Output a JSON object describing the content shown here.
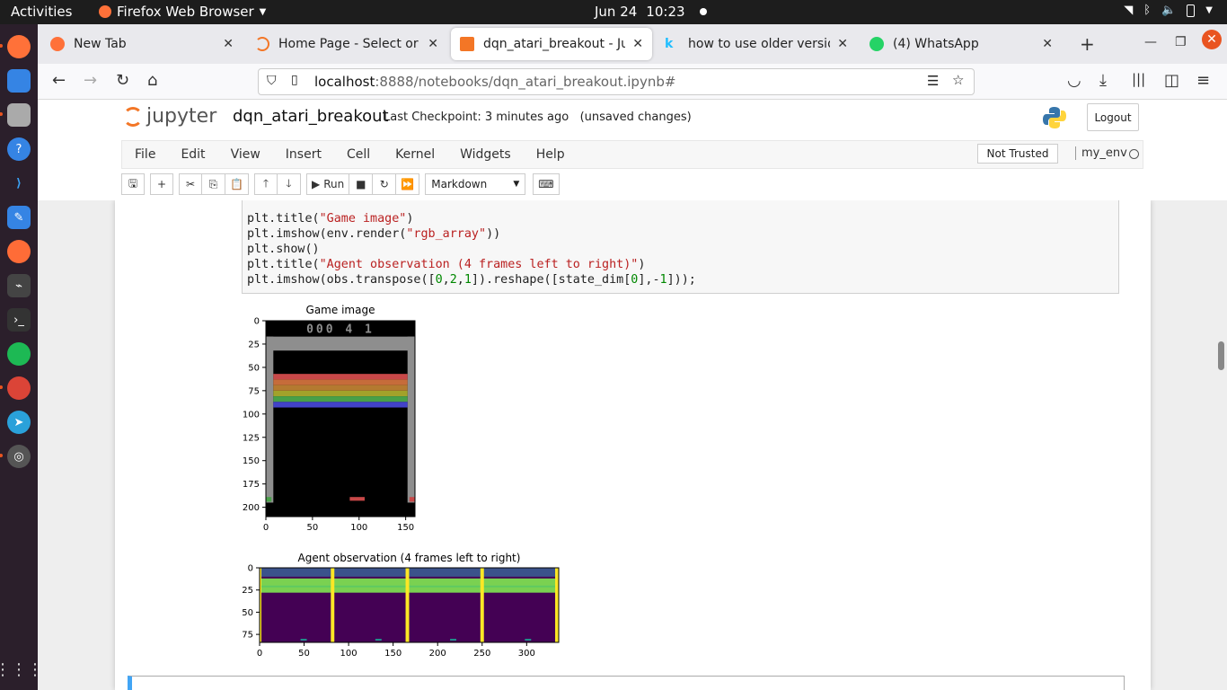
{
  "topbar": {
    "activities": "Activities",
    "app_name": "Firefox Web Browser",
    "date": "Jun 24",
    "time": "10:23"
  },
  "tabs": [
    {
      "label": "New Tab",
      "color": "#ff7139"
    },
    {
      "label": "Home Page - Select or create",
      "color": "#f37626"
    },
    {
      "label": "dqn_atari_breakout - Jup",
      "color": "#f37626"
    },
    {
      "label": "how to use older version",
      "color": "#20beff"
    },
    {
      "label": "(4) WhatsApp",
      "color": "#25d366"
    }
  ],
  "url": {
    "host": "localhost",
    "rest": ":8888/notebooks/dqn_atari_breakout.ipynb#"
  },
  "jupyter": {
    "logo_text": "jupyter",
    "notebook_name": "dqn_atari_breakout",
    "checkpoint": "Last Checkpoint: 3 minutes ago",
    "unsaved": "(unsaved changes)",
    "logout": "Logout",
    "menu": [
      "File",
      "Edit",
      "View",
      "Insert",
      "Cell",
      "Kernel",
      "Widgets",
      "Help"
    ],
    "trusted": "Not Trusted",
    "kernel": "my_env",
    "run_label": "Run",
    "cell_type": "Markdown"
  },
  "code_lines": [
    "plt.title(\"Game image\")",
    "plt.imshow(env.render(\"rgb_array\"))",
    "plt.show()",
    "plt.title(\"Agent observation (4 frames left to right)\")",
    "plt.imshow(obs.transpose([0,2,1]).reshape([state_dim[0],-1]));"
  ],
  "chart_data": [
    {
      "type": "heatmap",
      "title": "Game image",
      "xlabel": "",
      "ylabel": "",
      "xticks": [
        0,
        50,
        100,
        150
      ],
      "yticks": [
        0,
        25,
        50,
        75,
        100,
        125,
        150,
        175,
        200
      ],
      "xlim": [
        0,
        160
      ],
      "ylim": [
        210,
        0
      ],
      "score_text": "000 4 1",
      "colors": {
        "bricks": [
          "#c84848",
          "#c66c3a",
          "#b47a30",
          "#a2a22a",
          "#48a048",
          "#4242c8"
        ],
        "wall": "#8e8e8e",
        "paddle": "#c84848"
      }
    },
    {
      "type": "heatmap",
      "title": "Agent observation (4 frames left to right)",
      "xlabel": "",
      "ylabel": "",
      "xticks": [
        0,
        50,
        100,
        150,
        200,
        250,
        300
      ],
      "yticks": [
        0,
        25,
        50,
        75
      ],
      "xlim": [
        0,
        336
      ],
      "ylim": [
        84,
        0
      ],
      "colors": {
        "background": "#440154",
        "band": "#7ad151",
        "wall": "#fde725",
        "paddle": "#21918c"
      }
    }
  ]
}
